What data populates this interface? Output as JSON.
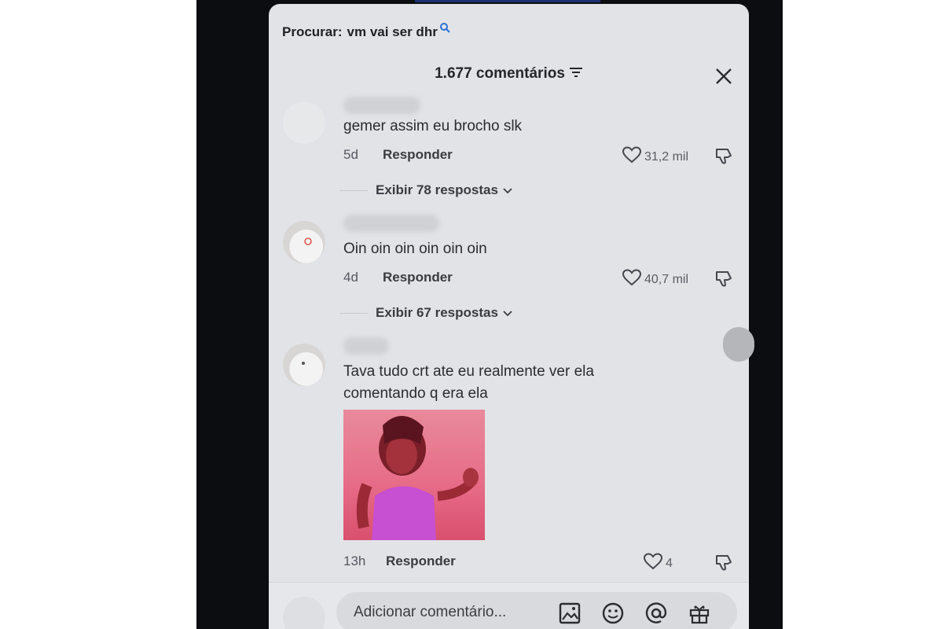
{
  "search": {
    "label": "Procurar:",
    "query": "vm vai ser dhr"
  },
  "header": {
    "count_title": "1.677 comentários"
  },
  "comments": [
    {
      "text": "gemer assim eu brocho slk",
      "time": "5d",
      "reply_label": "Responder",
      "likes": "31,2 mil",
      "replies_label": "Exibir 78 respostas"
    },
    {
      "text": "Oin oin oin oin oin oin",
      "time": "4d",
      "reply_label": "Responder",
      "likes": "40,7 mil",
      "replies_label": "Exibir 67 respostas"
    },
    {
      "text_line1": "Tava tudo crt ate eu realmente ver ela",
      "text_line2": "comentando q era ela",
      "time": "13h",
      "reply_label": "Responder",
      "likes": "4"
    }
  ],
  "compose": {
    "placeholder": "Adicionar comentário..."
  },
  "icons": {
    "search": "search-icon",
    "sort": "sort-icon",
    "close": "close-icon",
    "like": "heart-icon",
    "dislike": "dislike-icon",
    "chevron": "chevron-down-icon",
    "image": "image-icon",
    "emoji": "emoji-icon",
    "mention": "at-icon",
    "gift": "gift-icon"
  },
  "colors": {
    "sheet": "#e1e3e7",
    "background": "#0b0d10",
    "text": "#2a2c30"
  }
}
